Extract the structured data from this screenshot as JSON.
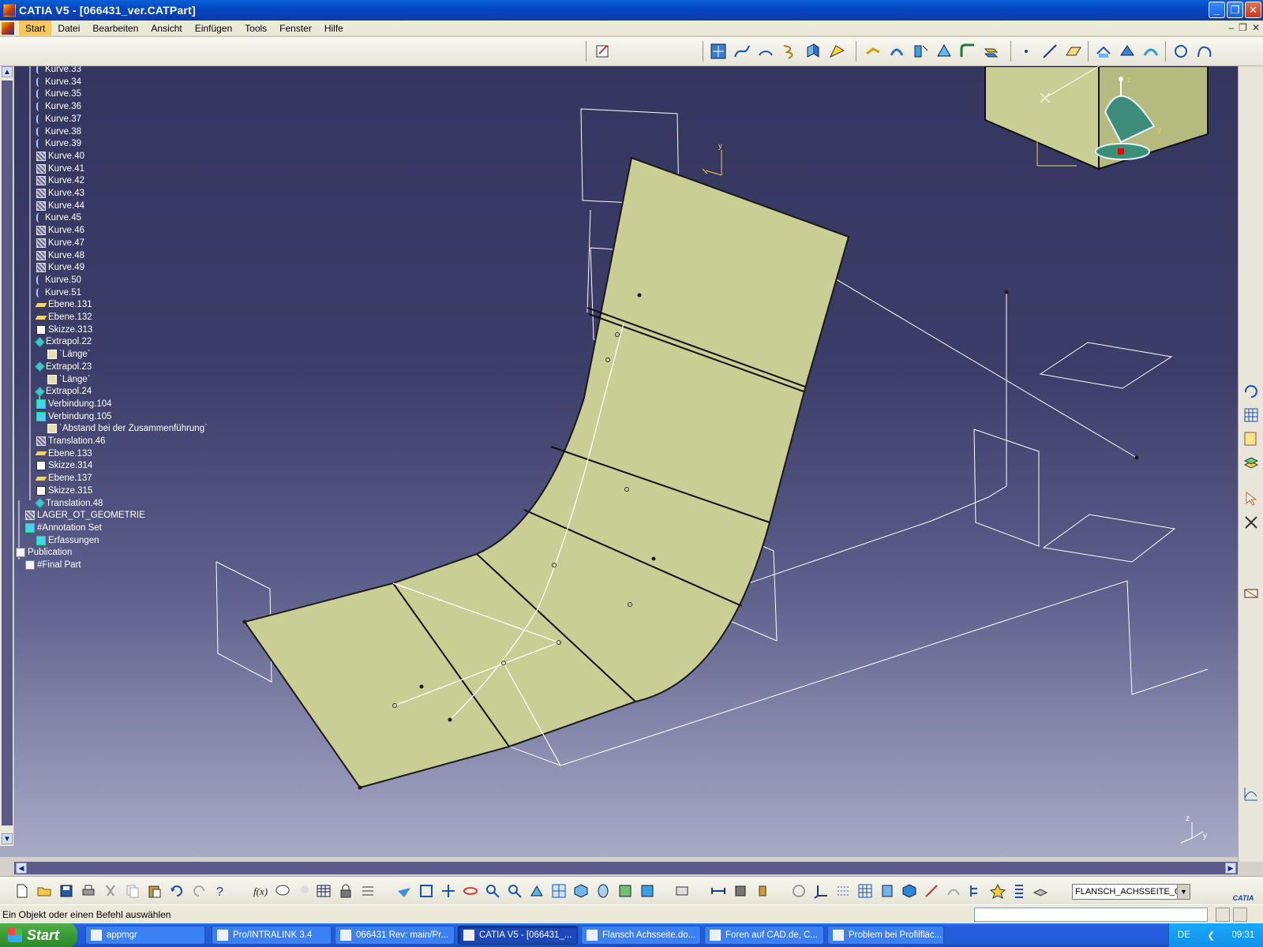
{
  "window": {
    "title": "CATIA V5 - [066431_ver.CATPart]",
    "buttons": {
      "minimize": "_",
      "restore": "❐",
      "close": "✕"
    }
  },
  "menu": {
    "items": [
      "Start",
      "Datei",
      "Bearbeiten",
      "Ansicht",
      "Einfügen",
      "Tools",
      "Fenster",
      "Hilfe"
    ],
    "active": "Start"
  },
  "tree": {
    "items": [
      {
        "label": "Kurve.33",
        "icon": "curve-icon",
        "indent": 2
      },
      {
        "label": "Kurve.34",
        "icon": "curve-icon",
        "indent": 2
      },
      {
        "label": "Kurve.35",
        "icon": "curve-icon",
        "indent": 2
      },
      {
        "label": "Kurve.36",
        "icon": "curve-icon",
        "indent": 2
      },
      {
        "label": "Kurve.37",
        "icon": "curve-icon",
        "indent": 2
      },
      {
        "label": "Kurve.38",
        "icon": "curve-icon",
        "indent": 2
      },
      {
        "label": "Kurve.39",
        "icon": "curve-icon",
        "indent": 2
      },
      {
        "label": "Kurve.40",
        "icon": "hidden-curve-icon",
        "indent": 2
      },
      {
        "label": "Kurve.41",
        "icon": "hidden-curve-icon",
        "indent": 2
      },
      {
        "label": "Kurve.42",
        "icon": "hidden-curve-icon",
        "indent": 2
      },
      {
        "label": "Kurve.43",
        "icon": "hidden-curve-icon",
        "indent": 2
      },
      {
        "label": "Kurve.44",
        "icon": "hidden-curve-icon",
        "indent": 2
      },
      {
        "label": "Kurve.45",
        "icon": "curve-icon",
        "indent": 2
      },
      {
        "label": "Kurve.46",
        "icon": "hidden-curve-icon",
        "indent": 2
      },
      {
        "label": "Kurve.47",
        "icon": "hidden-curve-icon",
        "indent": 2
      },
      {
        "label": "Kurve.48",
        "icon": "hidden-curve-icon",
        "indent": 2
      },
      {
        "label": "Kurve.49",
        "icon": "hidden-curve-icon",
        "indent": 2
      },
      {
        "label": "Kurve.50",
        "icon": "curve-icon",
        "indent": 2
      },
      {
        "label": "Kurve.51",
        "icon": "curve-icon",
        "indent": 2
      },
      {
        "label": "Ebene.131",
        "icon": "plane-icon",
        "indent": 2
      },
      {
        "label": "Ebene.132",
        "icon": "plane-icon",
        "indent": 2
      },
      {
        "label": "Skizze.313",
        "icon": "sketch-icon",
        "indent": 2
      },
      {
        "label": "Extrapol.22",
        "icon": "extrapolate-icon",
        "indent": 2
      },
      {
        "label": "`Länge`",
        "icon": "parameter-icon",
        "indent": 3
      },
      {
        "label": "Extrapol.23",
        "icon": "extrapolate-icon",
        "indent": 2
      },
      {
        "label": "`Länge`",
        "icon": "parameter-icon",
        "indent": 3
      },
      {
        "label": "Extrapol.24",
        "icon": "extrapolate-icon",
        "indent": 2
      },
      {
        "label": "Verbindung.104",
        "icon": "join-icon",
        "indent": 2
      },
      {
        "label": "Verbindung.105",
        "icon": "join-icon",
        "indent": 2
      },
      {
        "label": "`Abstand bei der Zusammenführung`",
        "icon": "parameter-icon",
        "indent": 3
      },
      {
        "label": "Translation.46",
        "icon": "hidden-curve-icon",
        "indent": 2
      },
      {
        "label": "Ebene.133",
        "icon": "plane-icon",
        "indent": 2
      },
      {
        "label": "Skizze.314",
        "icon": "sketch-icon",
        "indent": 2
      },
      {
        "label": "Ebene.137",
        "icon": "plane-icon",
        "indent": 2
      },
      {
        "label": "Skizze.315",
        "icon": "sketch-icon",
        "indent": 2
      },
      {
        "label": "Translation.48",
        "icon": "translation-icon",
        "indent": 2
      },
      {
        "label": "LAGER_OT_GEOMETRIE",
        "icon": "hidden-curve-icon",
        "indent": 1
      },
      {
        "label": "#Annotation Set",
        "icon": "annotation-set-icon",
        "indent": 1
      },
      {
        "label": "Erfassungen",
        "icon": "capture-icon",
        "indent": 2
      },
      {
        "label": "Publication",
        "icon": "publication-icon",
        "indent": 0
      },
      {
        "label": "#Final Part",
        "icon": "part-icon",
        "indent": 1
      }
    ]
  },
  "viewport": {
    "surface_color": "#c9cf94",
    "background_top": "#353660",
    "background_bottom": "#a9aac6",
    "compass_labels": {
      "x": "x",
      "y": "y",
      "z": "z"
    },
    "axis_labels": {
      "x": "x",
      "y": "y",
      "z": "z"
    }
  },
  "layer": {
    "selected": "FLANSCH_ACHSSEITE_GE("
  },
  "brand": {
    "logo_text": "CATIA"
  },
  "status": {
    "message": "Ein Objekt oder einen Befehl auswählen",
    "command_value": ""
  },
  "taskbar": {
    "start_label": "Start",
    "tasks": [
      {
        "label": "appmgr",
        "active": false
      },
      {
        "label": "Pro/INTRALINK 3.4",
        "active": false
      },
      {
        "label": "066431 Rev: main/Pr...",
        "active": false
      },
      {
        "label": "CATIA V5 - [066431_...",
        "active": true
      },
      {
        "label": "Flansch Achsseite.do...",
        "active": false
      },
      {
        "label": "Foren auf CAD.de, C...",
        "active": false
      },
      {
        "label": "Problem bei Profilfläc...",
        "active": false
      }
    ],
    "language": "DE",
    "clock": "09:31"
  }
}
